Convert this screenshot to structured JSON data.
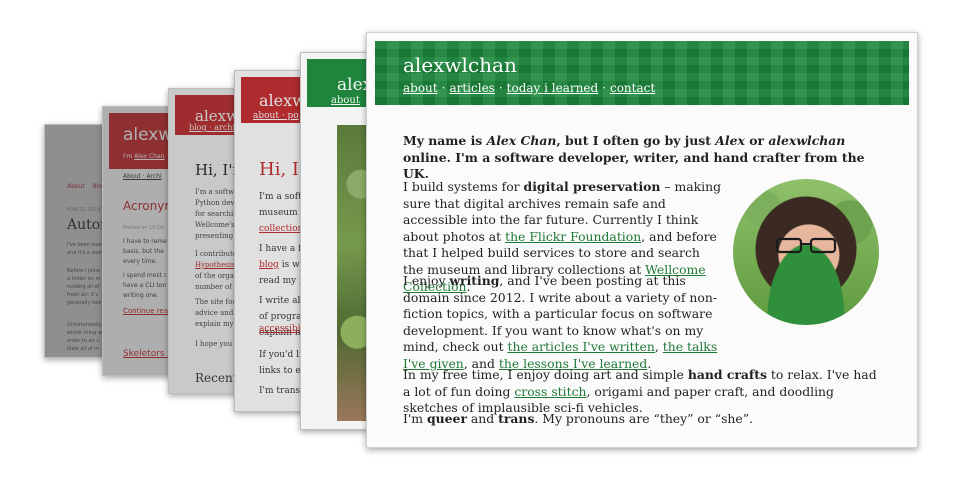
{
  "card1": {
    "nav": [
      "About",
      "Blog"
    ],
    "meta": "MAR 01 2019",
    "title": "Autom",
    "paragraphs": [
      "I've been woo",
      "and it's a won",
      "Before I joine",
      "a folder on m",
      "holding all of",
      "fresh air: it's",
      "generally bee",
      "Unfortunately",
      "whole thing w",
      "order to an c",
      "blew all of m"
    ]
  },
  "card2": {
    "logo": "alexwl",
    "sub_prefix": "I'm",
    "sub_link": "Alex Chan",
    "nav_line": "About · Archi",
    "title": "Acronym",
    "meta": "Posted on 10 De",
    "paragraphs": [
      "I have to reme",
      "basis, but the",
      "every time.",
      "I spend most c",
      "have a CLI too",
      "writing one."
    ],
    "more_link": "Continue rea",
    "next_title": "Skeletors A"
  },
  "card3": {
    "logo": "alexwlc",
    "nav": "blog · archiv",
    "heading": "Hi, I'm A",
    "p1": [
      "I'm a softw",
      "Python deve",
      "for searchin",
      "Wellcome's",
      "presenting t"
    ],
    "p2_prefix": "I contribute",
    "p2_link": "Hypothesis",
    "p2_rest": [
      "of the organ",
      "number of t"
    ],
    "p3": [
      "The site focu",
      "advice and V",
      "explain my l"
    ],
    "p4": "I hope you e",
    "recent": "Recent p"
  },
  "card4": {
    "logo": "alexwl",
    "nav": "about · po",
    "heading": "Hi, I'm",
    "p1": [
      "I'm a softw",
      "museum a"
    ],
    "p1_link": "collections",
    "p2": [
      "I have a fa"
    ],
    "p2_link": "blog",
    "p2_rest_inline": " is whe",
    "p2_rest": "read my po",
    "p3": [
      "I write abo",
      "of program",
      "explain my"
    ],
    "p3_link": "accessibili",
    "p4": [
      "If you'd lik",
      "links to ev"
    ],
    "p5": "I'm trans,"
  },
  "card5": {
    "logo": "alexw",
    "nav": "about"
  },
  "main": {
    "logo": "alexwlchan",
    "nav": [
      "about",
      "articles",
      "today i learned",
      "contact"
    ],
    "nav_sep": "·",
    "intro": {
      "a": "My name is ",
      "name": "Alex Chan",
      "b": ", but I often go by just ",
      "alex": "Alex",
      "c": " or ",
      "handle": "alexwlchan",
      "d": " online. I'm a software developer, writer, and hand crafter from the UK."
    },
    "p1": {
      "a": "I build systems for ",
      "bold": "digital preservation",
      "b": " – making sure that digital archives remain safe and accessible into the far future. Currently I think about photos at ",
      "link1": "the Flickr Foundation",
      "c": ", and before that I helped build services to store and search the museum and library collections at ",
      "link2": "Wellcome Collection",
      "d": "."
    },
    "p2": {
      "a": "I enjoy ",
      "bold": "writing",
      "b": ", and I've been posting at this domain since 2012. I write about a variety of non-fiction topics, with a particular focus on software development. If you want to know what's on my mind, check out ",
      "link1": "the articles I've written",
      "c": ", ",
      "link2": "the talks I've given",
      "d": ", and ",
      "link3": "the lessons I've learned",
      "e": "."
    },
    "p3": {
      "a": "In my free time, I enjoy doing art and simple ",
      "bold": "hand crafts",
      "b": " to relax. I've had a lot of fun doing ",
      "link1": "cross stitch",
      "c": ", origami and paper craft, and doodling sketches of implausible sci-fi vehicles."
    },
    "p4": {
      "a": "I'm ",
      "bold1": "queer",
      "b": " and ",
      "bold2": "trans",
      "c": ". My pronouns are “they” or “she”."
    }
  },
  "colors": {
    "green": "#1e8a3e",
    "red": "#c5282a",
    "link_green": "#1f7a36"
  }
}
